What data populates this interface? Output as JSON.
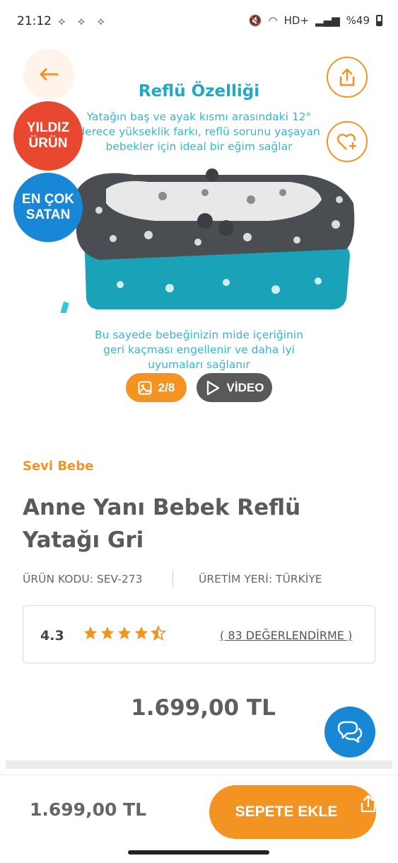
{
  "status_bar": {
    "time": "21:12",
    "left_icons": "⟡ ⟡ ⟡",
    "network": "HD+",
    "battery": "%49"
  },
  "hero": {
    "title": "Reflü Özelliği",
    "text_top_line1": "Yatağın baş ve ayak kısmı arasındaki 12°",
    "text_top_line2": "derece yükseklik farkı, reflü sorunu yaşayan",
    "text_top_line3": "bebekler için ideal bir eğim sağlar",
    "text_bottom_line1": "Bu sayede bebeğinizin mide içeriğinin",
    "text_bottom_line2": "geri kaçması engellenir ve daha iyi",
    "text_bottom_line3": "uyumaları sağlanır",
    "back_icon": "arrow-left",
    "share_icon": "share",
    "fav_icon": "heart-plus"
  },
  "badges": {
    "star_line1": "YILDIZ",
    "star_line2": "ÜRÜN",
    "best_line1": "EN ÇOK",
    "best_line2": "SATAN"
  },
  "gallery": {
    "count": "2/8",
    "video_label": "VİDEO"
  },
  "product": {
    "brand": "Sevi Bebe",
    "title": "Anne Yanı Bebek Reflü Yatağı Gri",
    "code": "ÜRÜN KODU: SEV-273",
    "origin": "ÜRETİM YERİ: TÜRKİYE",
    "rating": "4.3",
    "rating_stars": 4.3,
    "reviews_link": "( 83 DEĞERLENDİRME )",
    "price": "1.699,00 TL"
  },
  "bottom_bar": {
    "price": "1.699,00 TL",
    "add_to_cart": "SEPETE EKLE"
  },
  "colors": {
    "accent": "#f39322",
    "teal": "#20a9c6",
    "blue": "#1787d6",
    "red": "#e8482f"
  }
}
